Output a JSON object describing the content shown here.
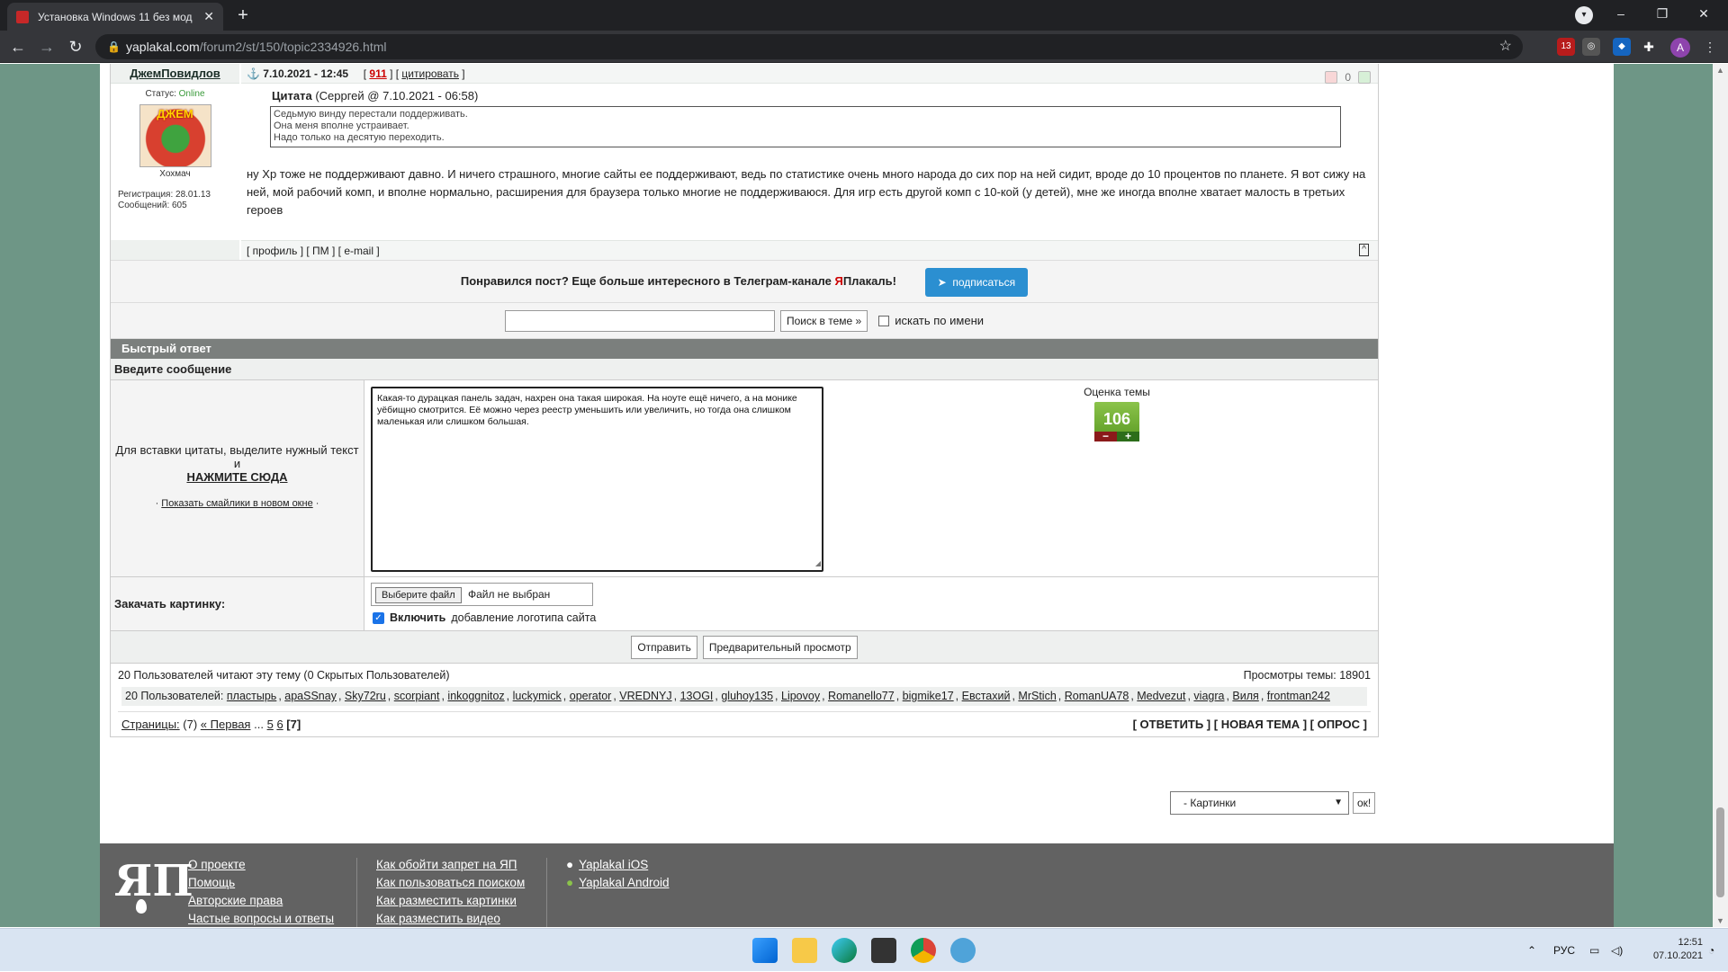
{
  "browser": {
    "tab_title": "Установка Windows 11 без мод",
    "url_domain": "yaplakal.com",
    "url_path": "/forum2/st/150/topic2334926.html",
    "ext_badge": "13",
    "avatar_letter": "A"
  },
  "post": {
    "username": "ДжемПовидлов",
    "date": "7.10.2021 - 12:45",
    "post_number": "911",
    "quote_link": "цитировать",
    "rating_count": "0",
    "status_label": "Статус:",
    "status_value": "Online",
    "avatar_caption": "Хохмач",
    "avatar_text": "ДЖЕМ",
    "registration": "Регистрация: 28.01.13",
    "messages": "Сообщений: 605",
    "quote_title": "Цитата",
    "quote_meta": "(Серргей @ 7.10.2021 - 06:58)",
    "quote_lines": [
      "Седьмую винду перестали поддерживать.",
      "Она меня вполне устраивает.",
      "Надо только на десятую переходить."
    ],
    "text": "ну Хр тоже не поддерживают давно. И ничего страшного, многие сайты ее поддерживают, ведь по статистике очень много народа до сих пор на ней сидит, вроде до 10 процентов по планете. Я вот сижу на ней, мой рабочий комп, и вполне нормально, расширения для браузера только многие не поддерживаюся. Для игр есть другой комп с 10-кой (у детей), мне же иногда вполне хватает малость в третьих героев",
    "links": [
      "профиль",
      "ПМ",
      "e-mail"
    ],
    "top_link": "^"
  },
  "promo": {
    "text_before": "Понравился пост? Еще больше интересного в Телеграм-канале ",
    "brand_red": "Я",
    "brand_rest": "Плакаль!",
    "button": "подписаться"
  },
  "search": {
    "button": "Поиск в теме »",
    "by_name": "искать по имени"
  },
  "reply": {
    "header": "Быстрый ответ",
    "subheader": "Введите сообщение",
    "hint": "Для вставки цитаты, выделите нужный текст и",
    "click_here": "НАЖМИТЕ СЮДА",
    "smileys": "Показать смайлики в новом окне",
    "message": "Какая-то дурацкая панель задач, нахрен она такая широкая. На ноуте ещё ничего, а на монике уёбищно смотрится. Её можно через реестр уменьшить или увеличить, но тогда она слишком маленькая или слишком большая.",
    "rating_label": "Оценка темы",
    "rating_value": "106",
    "upload_label": "Закачать картинку:",
    "file_button": "Выберите файл",
    "file_status": "Файл не выбран",
    "logo_bold": "Включить",
    "logo_rest": "добавление логотипа сайта",
    "send": "Отправить",
    "preview": "Предварительный просмотр"
  },
  "readers": {
    "summary": "20 Пользователей читают эту тему (0 Скрытых Пользователей)",
    "views": "Просмотры темы: 18901",
    "list_label": "20 Пользователей:",
    "users": [
      "пластырь",
      "apaSSnay",
      "Sky72ru",
      "scorpiant",
      "inkoggnitoz",
      "luckymick",
      "operator",
      "VREDNYJ",
      "13OGI",
      "gluhoy135",
      "Lipovoy",
      "Romanello77",
      "bigmike17",
      "Евстахий",
      "MrStich",
      "RomanUA78",
      "Medvezut",
      "viagra",
      "Виля",
      "frontman242"
    ]
  },
  "pager": {
    "label": "Страницы:",
    "count": "(7)",
    "first": "« Первая",
    "dots": "...",
    "p5": "5",
    "p6": "6",
    "current": "[7]",
    "actions": "[ ОТВЕТИТЬ ] [ НОВАЯ ТЕМА ] [ ОПРОС ]"
  },
  "jump": {
    "selected": "- Картинки",
    "ok": "ок!"
  },
  "footer": {
    "logo": "ЯП",
    "col1": [
      "О проекте",
      "Помощь",
      "Авторские права",
      "Частые вопросы и ответы"
    ],
    "col2": [
      "Как обойти запрет на ЯП",
      "Как пользоваться поиском",
      "Как разместить картинки",
      "Как разместить видео"
    ],
    "col3": [
      "Yaplakal iOS",
      "Yaplakal Android"
    ]
  },
  "taskbar": {
    "lang": "РУС",
    "time": "12:51",
    "date": "07.10.2021"
  }
}
